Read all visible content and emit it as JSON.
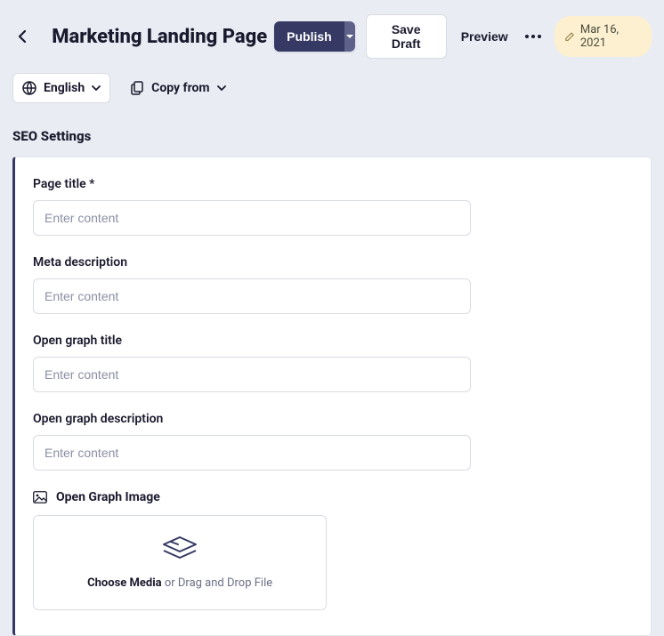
{
  "header": {
    "title": "Marketing Landing Page",
    "publish_label": "Publish",
    "save_draft_label": "Save Draft",
    "preview_label": "Preview",
    "date_label": "Mar 16, 2021"
  },
  "subbar": {
    "language_label": "English",
    "copy_from_label": "Copy from"
  },
  "section": {
    "title": "SEO Settings"
  },
  "fields": {
    "page_title": {
      "label": "Page title *",
      "placeholder": "Enter content"
    },
    "meta_description": {
      "label": "Meta description",
      "placeholder": "Enter content"
    },
    "og_title": {
      "label": "Open graph title",
      "placeholder": "Enter content"
    },
    "og_description": {
      "label": "Open graph description",
      "placeholder": "Enter content"
    },
    "og_image": {
      "label": "Open Graph Image",
      "choose_label": "Choose Media",
      "drop_label": " or Drag and Drop File"
    }
  }
}
